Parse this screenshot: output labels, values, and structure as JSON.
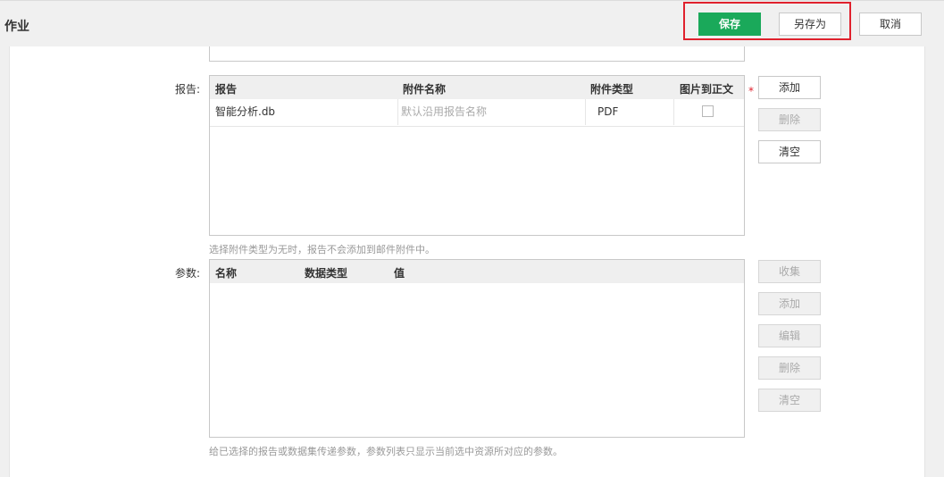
{
  "header": {
    "title": "作业",
    "save_label": "保存",
    "save_as_label": "另存为",
    "cancel_label": "取消"
  },
  "report": {
    "label": "报告:",
    "required_mark": "*",
    "columns": [
      "报告",
      "附件名称",
      "附件类型",
      "图片到正文"
    ],
    "rows": [
      {
        "report": "智能分析.db",
        "attachment_name_placeholder": "默认沿用报告名称",
        "attachment_type": "PDF",
        "image_to_body": false
      }
    ],
    "buttons": {
      "add": "添加",
      "delete": "删除",
      "clear": "清空"
    },
    "hint": "选择附件类型为无时，报告不会添加到邮件附件中。"
  },
  "params": {
    "label": "参数:",
    "columns": [
      "名称",
      "数据类型",
      "值"
    ],
    "buttons": {
      "collect": "收集",
      "add": "添加",
      "edit": "编辑",
      "delete": "删除",
      "clear": "清空"
    },
    "hint": "给已选择的报告或数据集传递参数，参数列表只显示当前选中资源所对应的参数。"
  },
  "colors": {
    "primary": "#1aa95a",
    "highlight": "#e0212d"
  }
}
